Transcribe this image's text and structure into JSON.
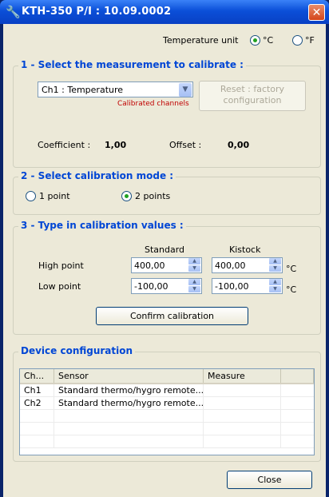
{
  "window": {
    "title": "KTH-350 P/I : 10.09.0002",
    "close_glyph": "✕"
  },
  "temperature_unit": {
    "label": "Temperature unit",
    "options": [
      "°C",
      "°F"
    ],
    "selected": "°C"
  },
  "section1": {
    "title": "1 - Select the measurement to calibrate :",
    "measurement_select": "Ch1 : Temperature",
    "calibrated_channels_note": "Calibrated channels",
    "reset_button": "Reset : factory configuration",
    "coefficient_label": "Coefficient :",
    "coefficient_value": "1,00",
    "offset_label": "Offset :",
    "offset_value": "0,00"
  },
  "section2": {
    "title": "2 - Select calibration mode :",
    "options": [
      "1 point",
      "2 points"
    ],
    "selected": "2 points"
  },
  "section3": {
    "title": "3 - Type in calibration values :",
    "col_standard": "Standard",
    "col_kistock": "Kistock",
    "high_label": "High point",
    "low_label": "Low point",
    "high_standard": "400,00",
    "high_kistock": "400,00",
    "low_standard": "-100,00",
    "low_kistock": "-100,00",
    "unit": "°C",
    "confirm_button": "Confirm calibration"
  },
  "device_config": {
    "title": "Device configuration",
    "columns": [
      "Ch...",
      "Sensor",
      "Measure"
    ],
    "rows": [
      {
        "ch": "Ch1",
        "sensor": "Standard thermo/hygro remote...",
        "measure": ""
      },
      {
        "ch": "Ch2",
        "sensor": "Standard thermo/hygro remote...",
        "measure": ""
      }
    ]
  },
  "close_button": "Close",
  "colors": {
    "titlebar": "#0b4fd8",
    "section_title": "#0046d5",
    "note_red": "#c00000",
    "face": "#ece9d8"
  }
}
